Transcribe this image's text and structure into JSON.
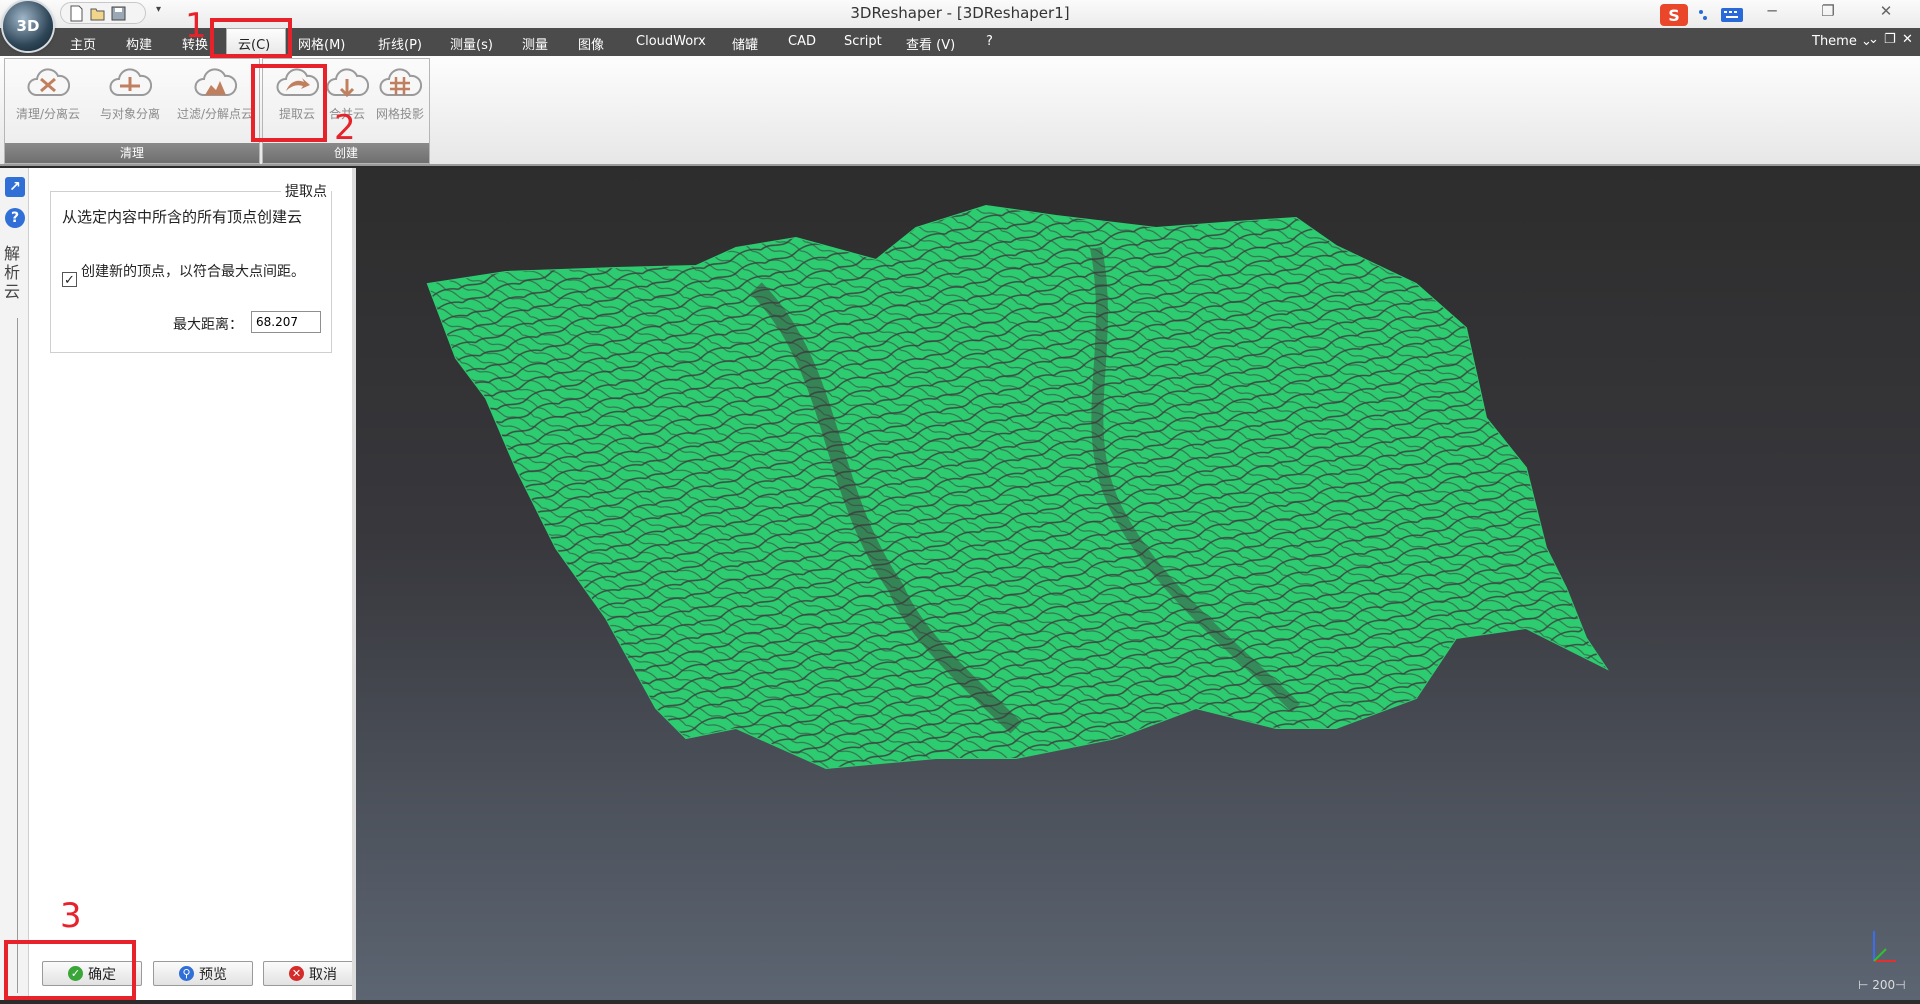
{
  "window": {
    "title": "3DReshaper - [3DReshaper1]",
    "logo_text": "3D",
    "quick_access_more": "▾",
    "ime_label": "S",
    "theme_label": "Theme"
  },
  "menu": {
    "items": [
      "主页",
      "构建",
      "转换",
      "云(C)",
      "网格(M)",
      "折线(P)",
      "测量(s)",
      "测量",
      "图像",
      "CloudWorx",
      "储罐",
      "CAD",
      "Script",
      "查看 (V)",
      "?"
    ]
  },
  "ribbon": {
    "groups": [
      {
        "label": "清理",
        "buttons": [
          "清理/分离云",
          "与对象分离",
          "过滤/分解点云"
        ]
      },
      {
        "label": "创建",
        "buttons": [
          "提取云",
          "合并云",
          "网格投影"
        ]
      }
    ]
  },
  "side": {
    "vertical_label": "解析云"
  },
  "panel": {
    "title": "提取点",
    "description": "从选定内容中所含的所有顶点创建云",
    "checkbox_label": "创建新的顶点，以符合最大点间距。",
    "checkbox_checked": true,
    "max_distance_label": "最大距离：",
    "max_distance_value": "68.207",
    "buttons": {
      "ok": "确定",
      "preview": "预览",
      "cancel": "取消"
    }
  },
  "annotations": [
    "1",
    "2",
    "3"
  ],
  "viewport": {
    "scale_label": "⊢ 200⊣",
    "mesh_color": "#2ecc71",
    "background_top": "#2d2d2d",
    "background_bottom": "#5c6572"
  },
  "colors": {
    "menubar": "#4b4b4b",
    "highlight": "#e8222a",
    "ribbon_icon": "#c08060"
  }
}
